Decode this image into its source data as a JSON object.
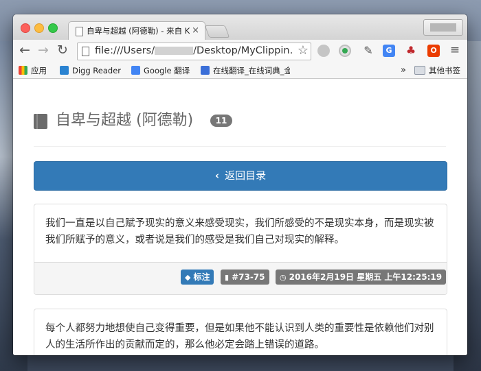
{
  "browser": {
    "tab_title": "自卑与超越 (阿德勒) - 来自 K",
    "tab_close": "×",
    "url_prefix": "file:///Users/",
    "url_suffix": "/Desktop/MyClippin…",
    "bookmarks": [
      {
        "label": "应用",
        "icon": "apps-grid-icon"
      },
      {
        "label": "Digg Reader",
        "icon": "digg-icon"
      },
      {
        "label": "Google 翻译",
        "icon": "google-translate-icon"
      },
      {
        "label": "在线翻译_在线词典_金",
        "icon": "iciba-icon"
      }
    ],
    "more_bookmarks": "»",
    "other_bookmarks": "其他书签"
  },
  "page": {
    "title": "自卑与超越 (阿德勒)",
    "count": "11",
    "back_label": "返回目录",
    "notes": [
      {
        "text": "我们一直是以自己赋予现实的意义来感受现实，我们所感受的不是现实本身，而是现实被我们所赋予的意义，或者说是我们的感受是我们自己对现实的解释。",
        "tag": "标注",
        "location": "#73-75",
        "time": "2016年2月19日 星期五 上午12:25:19"
      },
      {
        "text": "每个人都努力地想使自己变得重要，但是如果他不能认识到人类的重要性是依赖他们对别人的生活所作出的贡献而定的，那么他必定会踏上错误的道路。"
      }
    ]
  },
  "colors": {
    "primary": "#337ab7",
    "label_grey": "#777777",
    "badge": "#777777"
  }
}
